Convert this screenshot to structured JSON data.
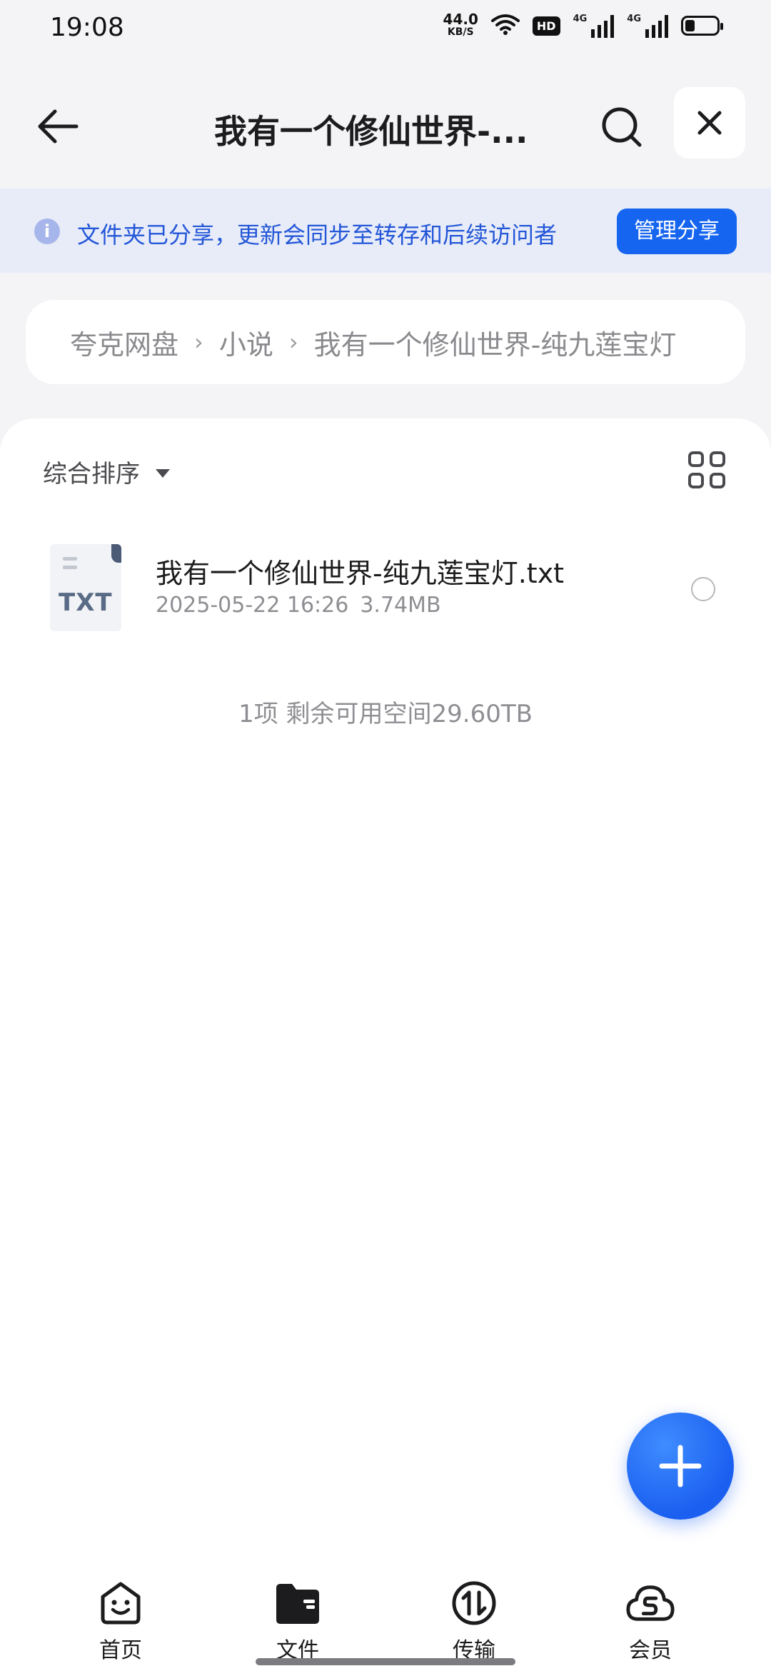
{
  "status_bar": {
    "time": "19:08",
    "net_speed": "44.0",
    "net_speed_unit": "KB/S",
    "hd_badge": "HD",
    "signal_1": "4G",
    "signal_2": "4G",
    "battery_level_fraction": 0.25
  },
  "header": {
    "title": "我有一个修仙世界-...",
    "back_icon": "arrow-left-icon",
    "search_icon": "search-icon",
    "close_icon": "close-icon"
  },
  "share_banner": {
    "icon": "info-icon",
    "icon_glyph": "i",
    "text": "文件夹已分享，更新会同步至转存和后续访问者",
    "button_label": "管理分享",
    "accent_color": "#1565f0",
    "background_color": "#e7ecf8"
  },
  "breadcrumb": {
    "items": [
      "夸克网盘",
      "小说",
      "我有一个修仙世界-纯九莲宝灯"
    ],
    "separator": "›"
  },
  "toolbar": {
    "sort_label": "综合排序",
    "view_toggle_icon": "grid-view-icon"
  },
  "files": [
    {
      "icon": "txt-file-icon",
      "icon_label": "TXT",
      "name": "我有一个修仙世界-纯九莲宝灯.txt",
      "date": "2025-05-22 16:26",
      "size": "3.74MB"
    }
  ],
  "summary": "1项 剩余可用空间29.60TB",
  "fab_icon": "plus-icon",
  "tabbar": {
    "tabs": [
      {
        "label": "首页",
        "icon": "home-face-icon"
      },
      {
        "label": "文件",
        "icon": "folder-icon",
        "active": true
      },
      {
        "label": "传输",
        "icon": "transfer-icon"
      },
      {
        "label": "会员",
        "icon": "member-cloud-icon"
      }
    ]
  }
}
